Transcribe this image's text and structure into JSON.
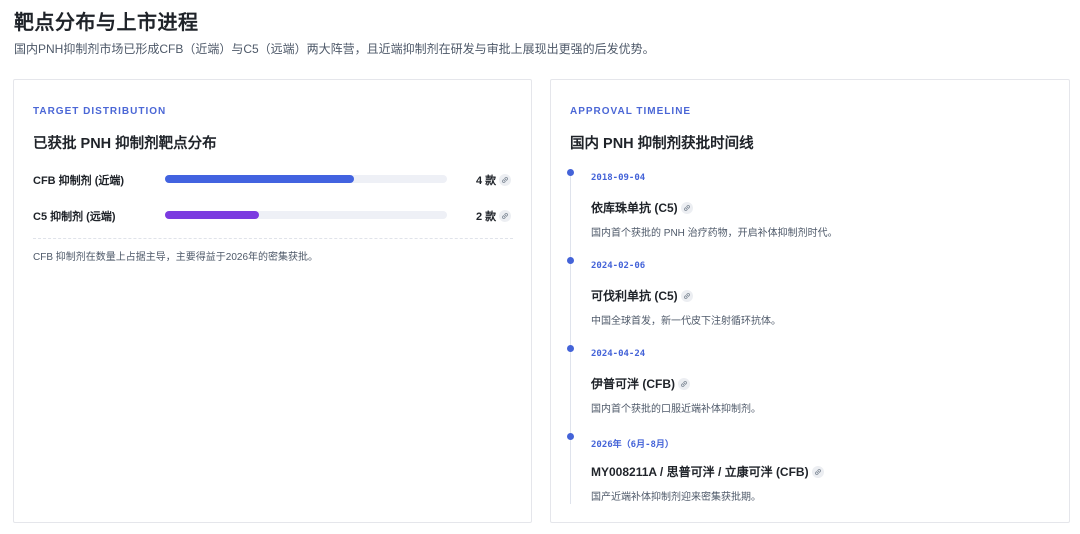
{
  "header": {
    "title": "靶点分布与上市进程",
    "subtitle": "国内PNH抑制剂市场已形成CFB（近端）与C5（远端）两大阵营，且近端抑制剂在研发与审批上展现出更强的后发优势。"
  },
  "distribution": {
    "eyebrow": "TARGET DISTRIBUTION",
    "title": "已获批 PNH 抑制剂靶点分布",
    "rows": [
      {
        "label": "CFB 抑制剂 (近端)",
        "count": "4 款",
        "fraction": 0.67,
        "color": "#4263e0"
      },
      {
        "label": "C5 抑制剂 (远端)",
        "count": "2 款",
        "fraction": 0.335,
        "color": "#7b3be0"
      }
    ],
    "note": "CFB 抑制剂在数量上占据主导，主要得益于2026年的密集获批。"
  },
  "timeline": {
    "eyebrow": "APPROVAL TIMELINE",
    "title": "国内 PNH 抑制剂获批时间线",
    "items": [
      {
        "date": "2018-09-04",
        "name": "依库珠单抗 (C5)",
        "desc": "国内首个获批的 PNH 治疗药物，开启补体抑制剂时代。"
      },
      {
        "date": "2024-02-06",
        "name": "可伐利单抗 (C5)",
        "desc": "中国全球首发，新一代皮下注射循环抗体。"
      },
      {
        "date": "2024-04-24",
        "name": "伊普可泮 (CFB)",
        "desc": "国内首个获批的口服近端补体抑制剂。"
      },
      {
        "date": "2026年（6月-8月）",
        "name": "MY008211A / 思普可泮 / 立康可泮 (CFB)",
        "desc": "国产近端补体抑制剂迎来密集获批期。"
      }
    ]
  },
  "colors": {
    "accent": "#4463d8",
    "purple": "#7b3be0",
    "text": "#1f2329",
    "muted": "#4e5969"
  },
  "icons": {
    "source_link": "link-icon"
  }
}
